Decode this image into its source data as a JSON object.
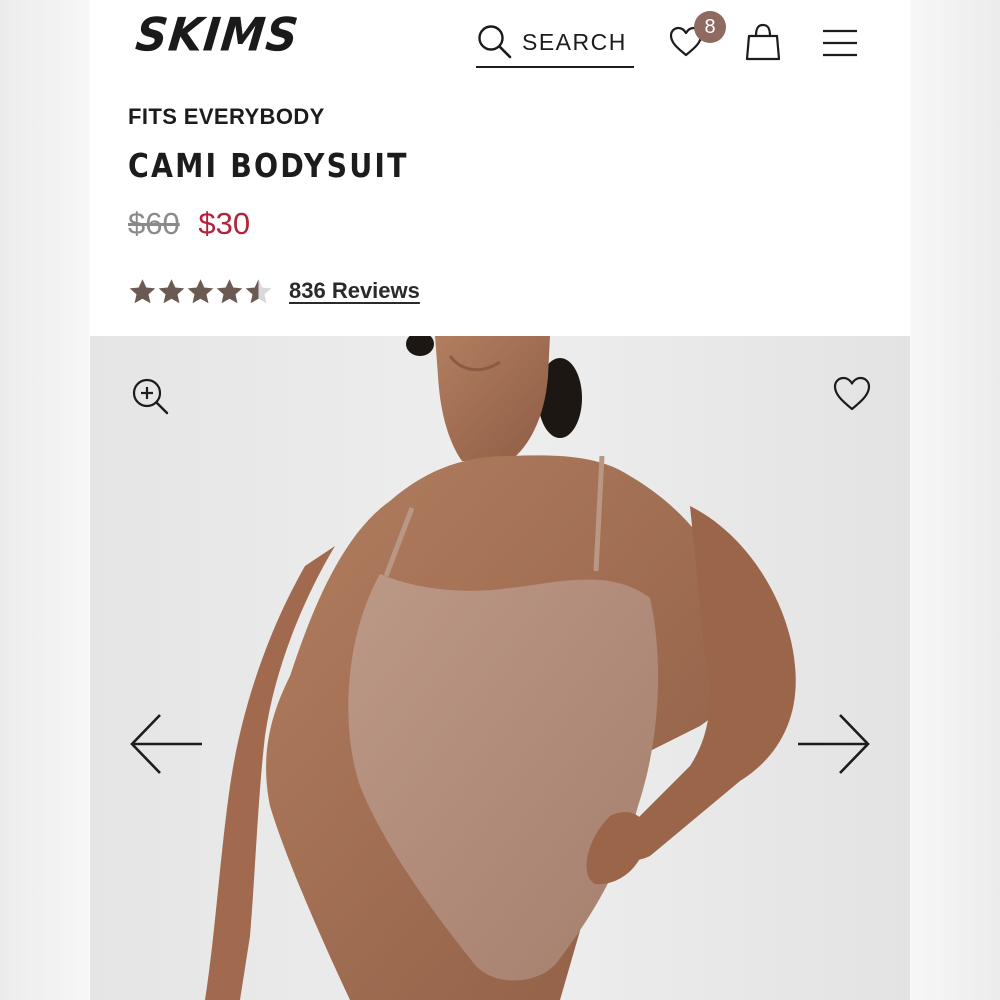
{
  "header": {
    "logo": "SKIMS",
    "search_label": "SEARCH",
    "wishlist_count": "8",
    "badge_color": "#8e6a60"
  },
  "product": {
    "collection": "FITS EVERYBODY",
    "name": "CAMI BODYSUIT",
    "price_original": "$60",
    "price_sale": "$30",
    "rating": 4.5,
    "rating_max": 5,
    "reviews_label": "836 Reviews",
    "sale_color": "#b3233d",
    "star_color": "#6b5a52"
  },
  "gallery": {
    "icons": [
      "zoom-in-icon",
      "heart-icon",
      "arrow-left-icon",
      "arrow-right-icon"
    ],
    "image_description_colors": {
      "background": "#e9e8e8",
      "garment": "#b48e7c",
      "skin": "#a67458"
    }
  }
}
